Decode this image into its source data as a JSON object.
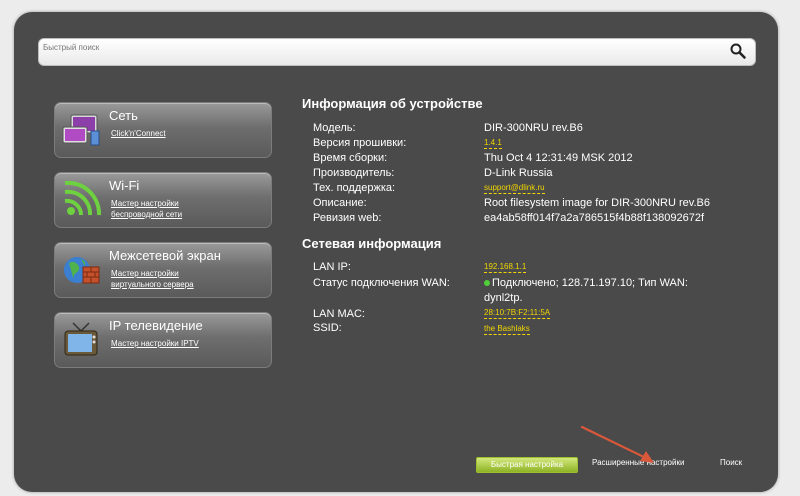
{
  "search": {
    "placeholder": "Быстрый поиск"
  },
  "menu": [
    {
      "title": "Сеть",
      "links": [
        "Click'n'Connect"
      ],
      "icon": "network-icon"
    },
    {
      "title": "Wi-Fi",
      "links": [
        "Мастер настройки",
        "беспроводной сети"
      ],
      "icon": "wifi-icon"
    },
    {
      "title": "Межсетевой экран",
      "links": [
        "Мастер настройки",
        "виртуального сервера"
      ],
      "icon": "firewall-icon"
    },
    {
      "title": "IP телевидение",
      "links": [
        "Мастер настройки IPTV"
      ],
      "icon": "tv-icon"
    }
  ],
  "device_info": {
    "heading": "Информация об устройстве",
    "rows": [
      {
        "label": "Модель:",
        "value": "DIR-300NRU rev.B6"
      },
      {
        "label": "Версия прошивки:",
        "value": "1.4.1"
      },
      {
        "label": "Время сборки:",
        "value": "Thu Oct 4 12:31:49 MSK 2012"
      },
      {
        "label": "Производитель:",
        "value": "D-Link Russia"
      },
      {
        "label": "Тех. поддержка:",
        "value": "support@dlink.ru"
      },
      {
        "label": "Описание:",
        "value": "Root filesystem image for DIR-300NRU rev.B6"
      },
      {
        "label": "Ревизия web:",
        "value": "ea4ab58ff014f7a2a786515f4b88f138092672f"
      }
    ]
  },
  "network_info": {
    "heading": "Сетевая информация",
    "rows": [
      {
        "label": "LAN IP:",
        "value": "192.168.1.1"
      },
      {
        "label": "Статус подключения WAN:",
        "value": "Подключено; 128.71.197.10; Тип WAN:",
        "value2": "dynl2tp."
      },
      {
        "label": "LAN MAC:",
        "value": "28:10:7B:F2:11:5A"
      },
      {
        "label": "SSID:",
        "value": "the Bashlaks"
      }
    ]
  },
  "bottom_nav": {
    "quick_setup": "Быстрая настройка",
    "advanced": "Расширенные настройки",
    "search": "Поиск"
  },
  "colors": {
    "panel": "#4a4a4a",
    "link_yellow": "#f2d600",
    "quick_button": "#9cc02f",
    "arrow": "#d9583a"
  }
}
